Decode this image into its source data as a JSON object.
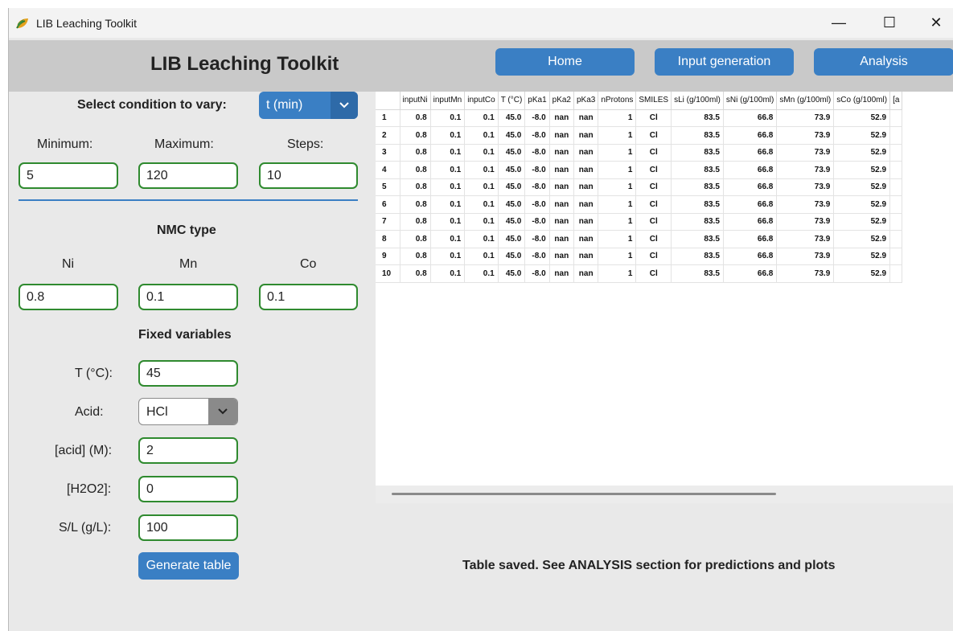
{
  "window": {
    "title": "LIB Leaching Toolkit",
    "controls": {
      "minimize": "—",
      "maximize": "☐",
      "close": "✕"
    }
  },
  "header": {
    "title": "LIB Leaching Toolkit",
    "nav": [
      "Home",
      "Input generation",
      "Analysis"
    ]
  },
  "vary": {
    "label": "Select condition to vary:",
    "selected": "t (min)",
    "min_label": "Minimum:",
    "max_label": "Maximum:",
    "steps_label": "Steps:",
    "min": "5",
    "max": "120",
    "steps": "10"
  },
  "nmc": {
    "title": "NMC type",
    "ni_label": "Ni",
    "mn_label": "Mn",
    "co_label": "Co",
    "ni": "0.8",
    "mn": "0.1",
    "co": "0.1"
  },
  "fixed": {
    "title": "Fixed variables",
    "t_label": "T (°C):",
    "t": "45",
    "acid_label": "Acid:",
    "acid": "HCl",
    "conc_label": "[acid] (M):",
    "conc": "2",
    "h2o2_label": "[H2O2]:",
    "h2o2": "0",
    "sl_label": "S/L (g/L):",
    "sl": "100"
  },
  "generate_label": "Generate table",
  "table": {
    "columns": [
      "inputNi",
      "inputMn",
      "inputCo",
      "T (°C)",
      "pKa1",
      "pKa2",
      "pKa3",
      "nProtons",
      "SMILES",
      "sLi (g/100ml)",
      "sNi (g/100ml)",
      "sMn (g/100ml)",
      "sCo (g/100ml)",
      "[a"
    ],
    "row_values": [
      "0.8",
      "0.1",
      "0.1",
      "45.0",
      "-8.0",
      "nan",
      "nan",
      "1",
      "Cl",
      "83.5",
      "66.8",
      "73.9",
      "52.9",
      ""
    ],
    "row_ids": [
      "1",
      "2",
      "3",
      "4",
      "5",
      "6",
      "7",
      "8",
      "9",
      "10"
    ]
  },
  "status": "Table saved. See ANALYSIS section for predictions and plots",
  "colors": {
    "accent": "#3a7fc4",
    "field_border": "#2f8a2f",
    "header_bg": "#c9c9c9"
  }
}
